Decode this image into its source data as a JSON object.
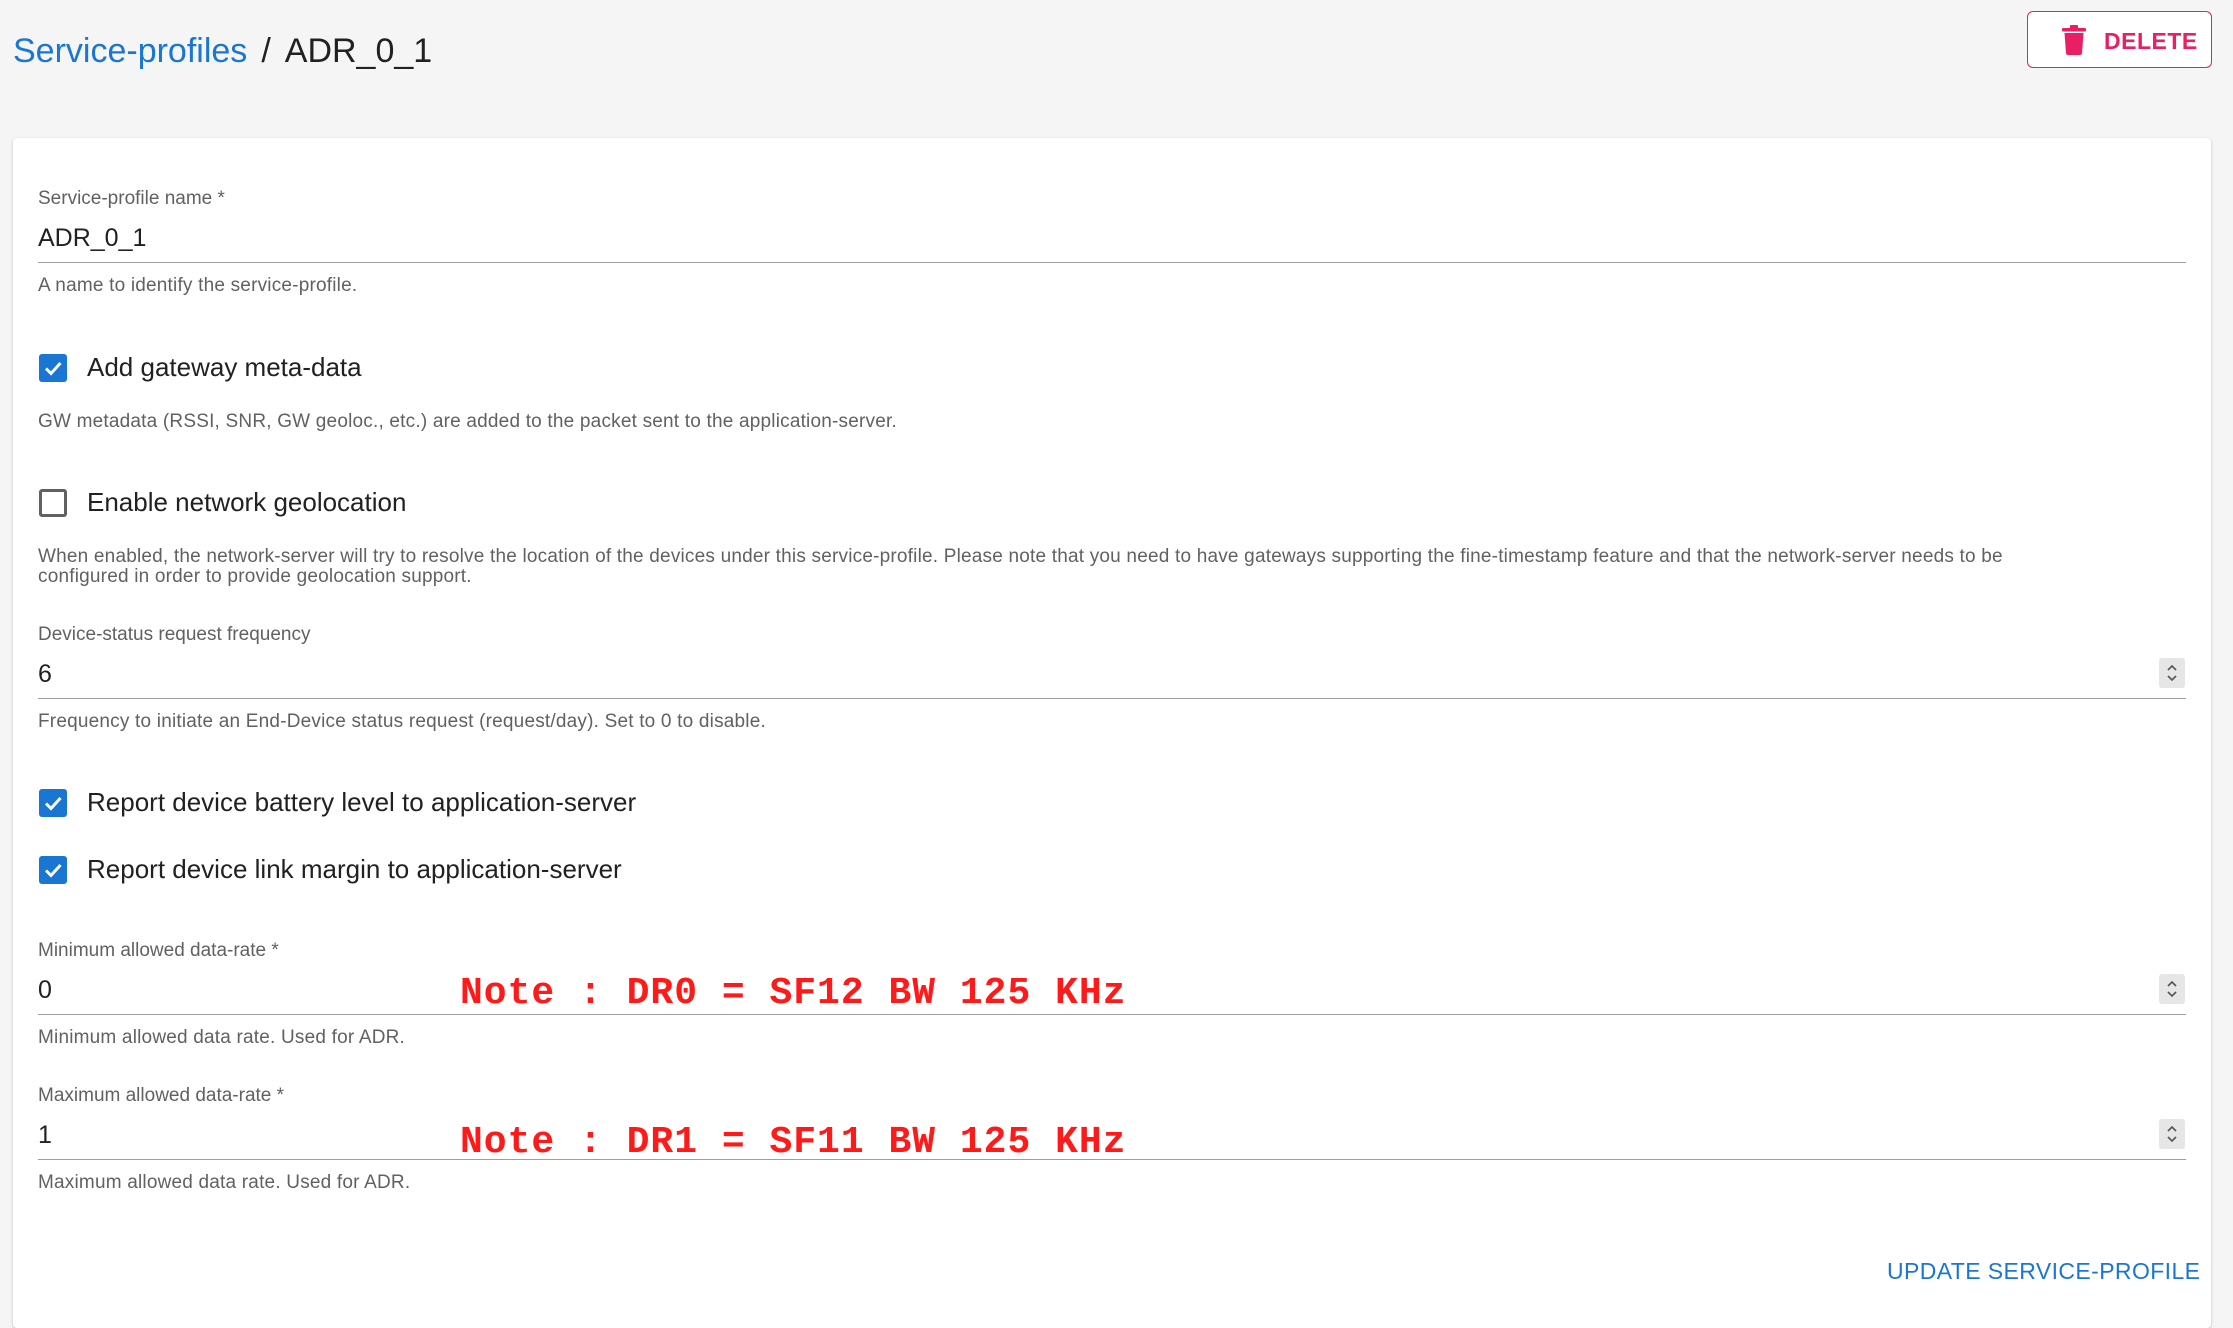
{
  "breadcrumb": {
    "parent": "Service-profiles",
    "separator": "/",
    "current": "ADR_0_1"
  },
  "actions": {
    "delete_label": "DELETE"
  },
  "form": {
    "name": {
      "label": "Service-profile name *",
      "value": "ADR_0_1",
      "helper": "A name to identify the service-profile."
    },
    "add_gw_metadata": {
      "label": "Add gateway meta-data",
      "checked": true,
      "helper": "GW metadata (RSSI, SNR, GW geoloc., etc.) are added to the packet sent to the application-server."
    },
    "network_geolocation": {
      "label": "Enable network geolocation",
      "checked": false,
      "helper_line1": "When enabled, the network-server will try to resolve the location of the devices under this service-profile. Please note that you need to have gateways supporting the fine-timestamp feature and that the network-server needs to be",
      "helper_line2": "configured in order to provide geolocation support."
    },
    "dev_status_freq": {
      "label": "Device-status request frequency",
      "value": "6",
      "helper": "Frequency to initiate an End-Device status request (request/day). Set to 0 to disable."
    },
    "report_battery": {
      "label": "Report device battery level to application-server",
      "checked": true
    },
    "report_margin": {
      "label": "Report device link margin to application-server",
      "checked": true
    },
    "min_dr": {
      "label": "Minimum allowed data-rate *",
      "value": "0",
      "helper": "Minimum allowed data rate. Used for ADR.",
      "note": "Note : DR0 = SF12 BW 125 KHz"
    },
    "max_dr": {
      "label": "Maximum allowed data-rate *",
      "value": "1",
      "helper": "Maximum allowed data rate. Used for ADR.",
      "note": "Note : DR1 = SF11 BW 125 KHz"
    },
    "submit_label": "UPDATE SERVICE-PROFILE"
  },
  "colors": {
    "primary": "#1976d2",
    "danger": "#e91e63",
    "annotation": "#ff1a1a"
  }
}
